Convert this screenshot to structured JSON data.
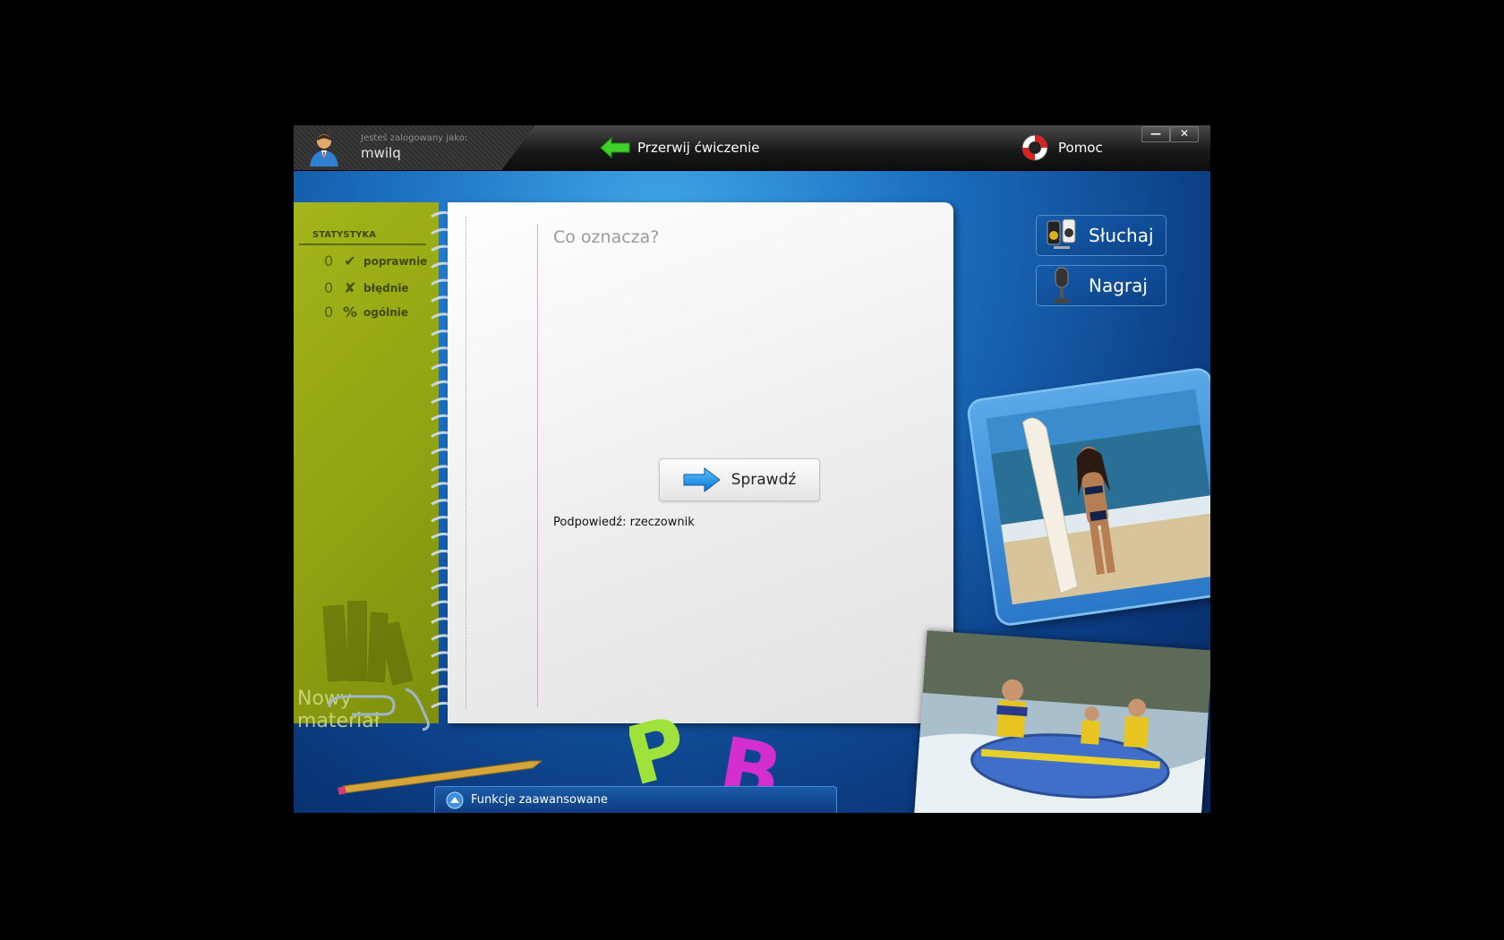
{
  "user": {
    "logged_label": "Jesteś zalogowany jako:",
    "name": "mwilq"
  },
  "toolbar": {
    "interrupt_label": "Przerwij ćwiczenie",
    "help_label": "Pomoc"
  },
  "window_controls": {
    "minimize": "—",
    "close": "✕"
  },
  "stats": {
    "title": "STATYSTYKA",
    "rows": [
      {
        "value": "0",
        "icon": "check-icon",
        "label": "poprawnie"
      },
      {
        "value": "0",
        "icon": "cross-icon",
        "label": "błędnie"
      },
      {
        "value": "0",
        "icon": "percent-icon",
        "label": "ogólnie"
      }
    ],
    "new_material": "Nowy materiał"
  },
  "exercise": {
    "question": "Co oznacza?",
    "check_label": "Sprawdź",
    "hint": "Podpowiedź:  rzeczownik"
  },
  "side_buttons": {
    "listen": "Słuchaj",
    "record": "Nagraj"
  },
  "bottom": {
    "advanced_label": "Funkcje zaawansowane"
  },
  "colors": {
    "accent_green": "#3fd12a",
    "sidebar": "#9aac16",
    "background_blue": "#1b6fc0"
  }
}
